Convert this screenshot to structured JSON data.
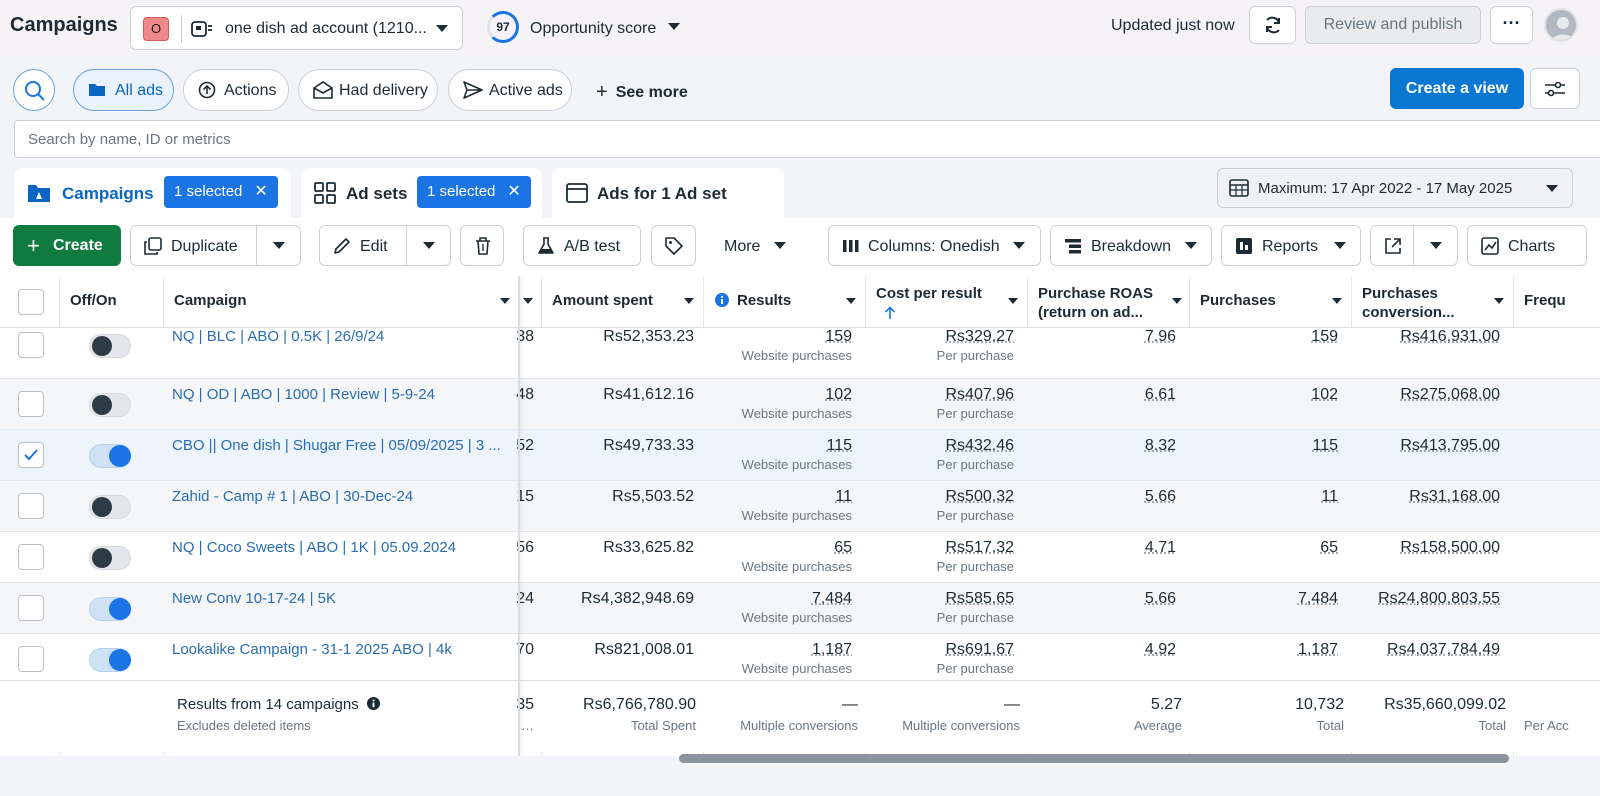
{
  "topbar": {
    "title": "Campaigns",
    "account_badge": "O",
    "account_name": "one dish ad account (1210...",
    "opportunity_score": "97",
    "opportunity_label": "Opportunity score",
    "updated": "Updated just now",
    "review_publish": "Review and publish",
    "more": "···"
  },
  "filters": {
    "chips": [
      "All ads",
      "Actions",
      "Had delivery",
      "Active ads"
    ],
    "see_more": "See more",
    "create_view": "Create a view",
    "search_placeholder": "Search by name, ID or metrics"
  },
  "tabs": {
    "campaigns": "Campaigns",
    "campaigns_selected": "1 selected",
    "adsets": "Ad sets",
    "adsets_selected": "1 selected",
    "ads": "Ads for 1 Ad set",
    "date_range": "Maximum: 17 Apr 2022 - 17 May 2025"
  },
  "toolbar": {
    "create": "Create",
    "duplicate": "Duplicate",
    "edit": "Edit",
    "ab_test": "A/B test",
    "more": "More",
    "columns": "Columns: Onedish",
    "breakdown": "Breakdown",
    "reports": "Reports",
    "charts": "Charts"
  },
  "table": {
    "headers": {
      "offon": "Off/On",
      "campaign": "Campaign",
      "amount_spent": "Amount spent",
      "results": "Results",
      "cost_per_result": "Cost per result",
      "roas_1": "Purchase ROAS",
      "roas_2": "(return on ad...",
      "purchases": "Purchases",
      "conv_1": "Purchases",
      "conv_2": "conversion...",
      "freq": "Frequ"
    },
    "rows": [
      {
        "checked": false,
        "on": false,
        "name": "NQ | BLC | ABO | 0.5K | 26/9/24",
        "hidden": "38",
        "spent": "Rs52,353.23",
        "results": "159",
        "results_sub": "Website purchases",
        "cpr": "Rs329.27",
        "cpr_sub": "Per purchase",
        "roas": "7.96",
        "purchases": "159",
        "conv": "Rs416,931.00"
      },
      {
        "checked": false,
        "on": false,
        "name": "NQ | OD | ABO | 1000 | Review | 5-9-24",
        "hidden": "48",
        "spent": "Rs41,612.16",
        "results": "102",
        "results_sub": "Website purchases",
        "cpr": "Rs407.96",
        "cpr_sub": "Per purchase",
        "roas": "6.61",
        "purchases": "102",
        "conv": "Rs275,068.00"
      },
      {
        "checked": true,
        "on": true,
        "name": "CBO || One dish | Shugar Free | 05/09/2025 | 3 ...",
        "hidden": "52",
        "spent": "Rs49,733.33",
        "results": "115",
        "results_sub": "Website purchases",
        "cpr": "Rs432.46",
        "cpr_sub": "Per purchase",
        "roas": "8.32",
        "purchases": "115",
        "conv": "Rs413,795.00"
      },
      {
        "checked": false,
        "on": false,
        "name": "Zahid - Camp # 1 | ABO | 30-Dec-24",
        "hidden": "15",
        "spent": "Rs5,503.52",
        "results": "11",
        "results_sub": "Website purchases",
        "cpr": "Rs500.32",
        "cpr_sub": "Per purchase",
        "roas": "5.66",
        "purchases": "11",
        "conv": "Rs31,168.00"
      },
      {
        "checked": false,
        "on": false,
        "name": "NQ | Coco Sweets | ABO | 1K | 05.09.2024",
        "hidden": "56",
        "spent": "Rs33,625.82",
        "results": "65",
        "results_sub": "Website purchases",
        "cpr": "Rs517.32",
        "cpr_sub": "Per purchase",
        "roas": "4.71",
        "purchases": "65",
        "conv": "Rs158,500.00"
      },
      {
        "checked": false,
        "on": true,
        "name": "New Conv 10-17-24 | 5K",
        "hidden": "24",
        "spent": "Rs4,382,948.69",
        "results": "7,484",
        "results_sub": "Website purchases",
        "cpr": "Rs585.65",
        "cpr_sub": "Per purchase",
        "roas": "5.66",
        "purchases": "7,484",
        "conv": "Rs24,800,803.55"
      },
      {
        "checked": false,
        "on": true,
        "name": "Lookalike Campaign - 31-1 2025 ABO | 4k",
        "hidden": "70",
        "spent": "Rs821,008.01",
        "results": "1,187",
        "results_sub": "Website purchases",
        "cpr": "Rs691.67",
        "cpr_sub": "Per purchase",
        "roas": "4.92",
        "purchases": "1,187",
        "conv": "Rs4,037,784.49"
      }
    ],
    "footer": {
      "title": "Results from 14 campaigns",
      "subtitle": "Excludes deleted items",
      "hidden": "35",
      "spent": "Rs6,766,780.90",
      "spent_sub": "Total Spent",
      "results": "—",
      "results_sub": "Multiple conversions",
      "cpr": "—",
      "cpr_sub": "Multiple conversions",
      "roas": "5.27",
      "roas_sub": "Average",
      "purchases": "10,732",
      "purchases_sub": "Total",
      "conv": "Rs35,660,099.02",
      "conv_sub": "Total",
      "freq_sub": "Per Acc"
    }
  },
  "colors": {
    "accent": "#1b74e4",
    "create_green": "#0f7b3f",
    "link": "#2a6db0"
  }
}
